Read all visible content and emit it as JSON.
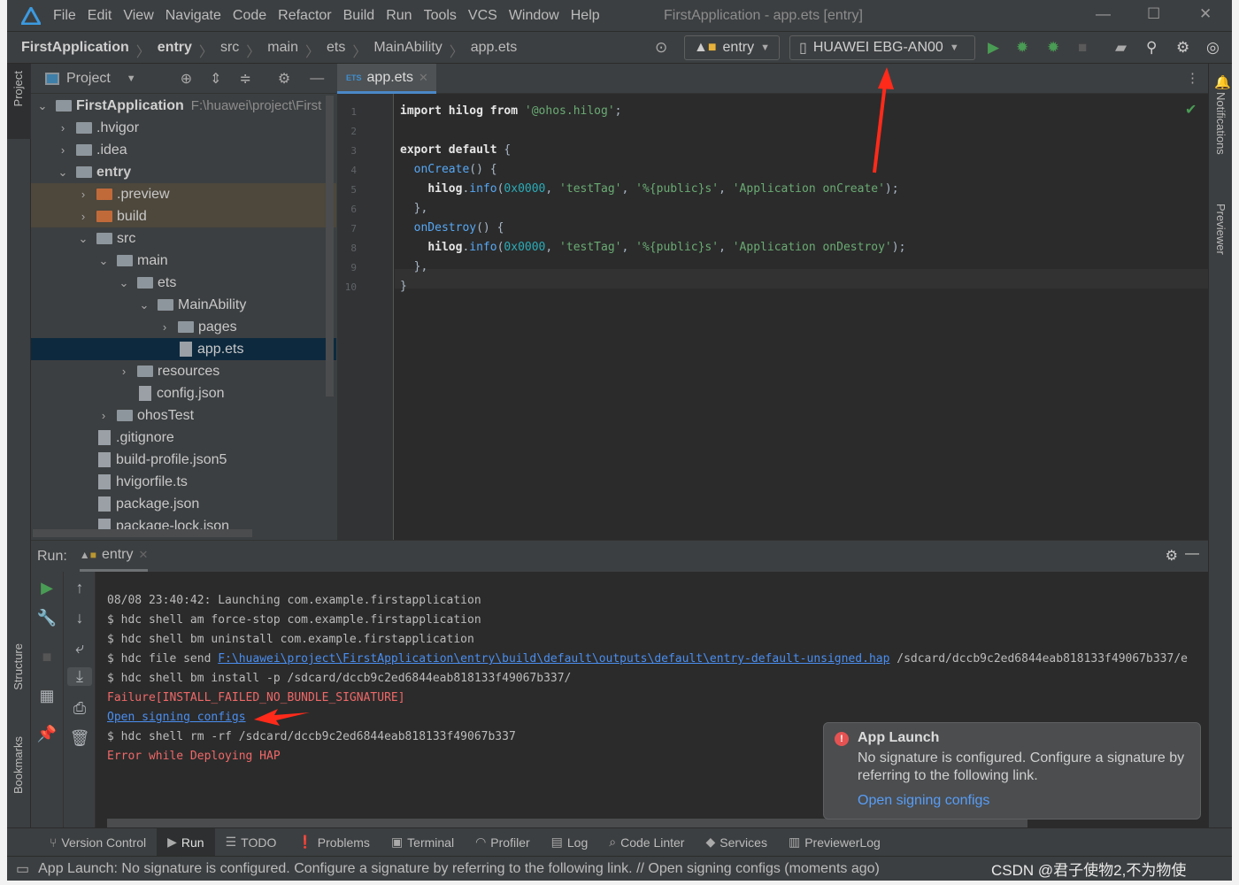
{
  "window": {
    "title": "FirstApplication - app.ets [entry]"
  },
  "menu": [
    "File",
    "Edit",
    "View",
    "Navigate",
    "Code",
    "Refactor",
    "Build",
    "Run",
    "Tools",
    "VCS",
    "Window",
    "Help"
  ],
  "breadcrumb": [
    "FirstApplication",
    "entry",
    "src",
    "main",
    "ets",
    "MainAbility",
    "app.ets"
  ],
  "toolbar": {
    "config": "entry",
    "device": "HUAWEI EBG-AN00"
  },
  "project": {
    "title": "Project",
    "root": {
      "label": "FirstApplication",
      "path": "F:\\huawei\\project\\First"
    },
    "items": [
      {
        "label": ".hvigor",
        "level": 1,
        "type": "folder",
        "expanded": false
      },
      {
        "label": ".idea",
        "level": 1,
        "type": "folder",
        "expanded": false
      },
      {
        "label": "entry",
        "level": 1,
        "type": "module",
        "expanded": true
      },
      {
        "label": ".preview",
        "level": 2,
        "type": "excluded",
        "expanded": false
      },
      {
        "label": "build",
        "level": 2,
        "type": "excluded",
        "expanded": false
      },
      {
        "label": "src",
        "level": 2,
        "type": "folder",
        "expanded": true
      },
      {
        "label": "main",
        "level": 3,
        "type": "folder",
        "expanded": true
      },
      {
        "label": "ets",
        "level": 4,
        "type": "folder",
        "expanded": true
      },
      {
        "label": "MainAbility",
        "level": 5,
        "type": "folder",
        "expanded": true
      },
      {
        "label": "pages",
        "level": 6,
        "type": "folder",
        "expanded": false
      },
      {
        "label": "app.ets",
        "level": 6,
        "type": "file",
        "selected": true
      },
      {
        "label": "resources",
        "level": 4,
        "type": "folder",
        "expanded": false
      },
      {
        "label": "config.json",
        "level": 4,
        "type": "file"
      },
      {
        "label": "ohosTest",
        "level": 3,
        "type": "folder",
        "expanded": false
      },
      {
        "label": ".gitignore",
        "level": 2,
        "type": "file"
      },
      {
        "label": "build-profile.json5",
        "level": 2,
        "type": "file"
      },
      {
        "label": "hvigorfile.ts",
        "level": 2,
        "type": "file"
      },
      {
        "label": "package.json",
        "level": 2,
        "type": "file"
      },
      {
        "label": "package-lock.json",
        "level": 2,
        "type": "file"
      }
    ]
  },
  "editor": {
    "tab": "app.ets",
    "lines": [
      [
        [
          "kw",
          "import "
        ],
        [
          "kw",
          "hilog "
        ],
        [
          "kw",
          "from "
        ],
        [
          "str",
          "'@ohos.hilog'"
        ],
        [
          "",
          "; "
        ]
      ],
      [],
      [
        [
          "kw",
          "export default "
        ],
        [
          "",
          "{"
        ]
      ],
      [
        [
          "",
          "  "
        ],
        [
          "fn",
          "onCreate"
        ],
        [
          "",
          "() {"
        ]
      ],
      [
        [
          "",
          "    "
        ],
        [
          "kw",
          "hilog"
        ],
        [
          "",
          "."
        ],
        [
          "fn",
          "info"
        ],
        [
          "",
          "("
        ],
        [
          "num",
          "0x0000"
        ],
        [
          ", "
        ],
        [
          "str",
          "'testTag'"
        ],
        [
          "",
          ", "
        ],
        [
          "str",
          "'%{public}s'"
        ],
        [
          "",
          ", "
        ],
        [
          "str",
          "'Application onCreate'"
        ],
        [
          "",
          ");"
        ]
      ],
      [
        [
          "",
          "  },"
        ]
      ],
      [
        [
          "",
          "  "
        ],
        [
          "fn",
          "onDestroy"
        ],
        [
          "",
          "() {"
        ]
      ],
      [
        [
          "",
          "    "
        ],
        [
          "kw",
          "hilog"
        ],
        [
          "",
          "."
        ],
        [
          "fn",
          "info"
        ],
        [
          "",
          "("
        ],
        [
          "num",
          "0x0000"
        ],
        [
          "",
          ", "
        ],
        [
          "str",
          "'testTag'"
        ],
        [
          "",
          ", "
        ],
        [
          "str",
          "'%{public}s'"
        ],
        [
          "",
          ", "
        ],
        [
          "str",
          "'Application onDestroy'"
        ],
        [
          "",
          ");"
        ]
      ],
      [
        [
          "",
          "  },"
        ]
      ],
      [
        [
          "",
          "}"
        ]
      ]
    ]
  },
  "run": {
    "label": "Run:",
    "tab": "entry",
    "console": [
      {
        "kind": "normal",
        "text": "08/08 23:40:42: Launching com.example.firstapplication"
      },
      {
        "kind": "normal",
        "text": "$ hdc shell am force-stop com.example.firstapplication"
      },
      {
        "kind": "normal",
        "text": "$ hdc shell bm uninstall com.example.firstapplication"
      },
      {
        "kind": "mixed",
        "prefix": "$ hdc file send ",
        "link": "F:\\huawei\\project\\FirstApplication\\entry\\build\\default\\outputs\\default\\entry-default-unsigned.hap",
        "suffix": " /sdcard/dccb9c2ed6844eab818133f49067b337/e"
      },
      {
        "kind": "normal",
        "text": "$ hdc shell bm install -p /sdcard/dccb9c2ed6844eab818133f49067b337/"
      },
      {
        "kind": "error",
        "text": "Failure[INSTALL_FAILED_NO_BUNDLE_SIGNATURE]"
      },
      {
        "kind": "link",
        "text": "Open signing configs"
      },
      {
        "kind": "normal",
        "text": "$ hdc shell rm -rf /sdcard/dccb9c2ed6844eab818133f49067b337"
      },
      {
        "kind": "error",
        "text": "Error while Deploying HAP"
      }
    ]
  },
  "notification": {
    "title": "App Launch",
    "body": "No signature is configured. Configure a signature by referring to the following link.",
    "link": "Open signing configs"
  },
  "side_tabs": {
    "left": [
      "Project",
      "Structure",
      "Bookmarks"
    ],
    "right": [
      "Notifications",
      "Previewer"
    ]
  },
  "bottom_tabs": [
    "Version Control",
    "Run",
    "TODO",
    "Problems",
    "Terminal",
    "Profiler",
    "Log",
    "Code Linter",
    "Services",
    "PreviewerLog"
  ],
  "status": {
    "message": "App Launch: No signature is configured. Configure a signature by referring to the following link. // Open signing configs (moments ago)",
    "watermark": "CSDN @君子使物2,不为物使"
  },
  "colors": {
    "accent": "#4a88c7",
    "run_green": "#499c54",
    "error": "#f06868",
    "link": "#4a8ef0",
    "annotation_arrow": "#ff2a1a"
  }
}
